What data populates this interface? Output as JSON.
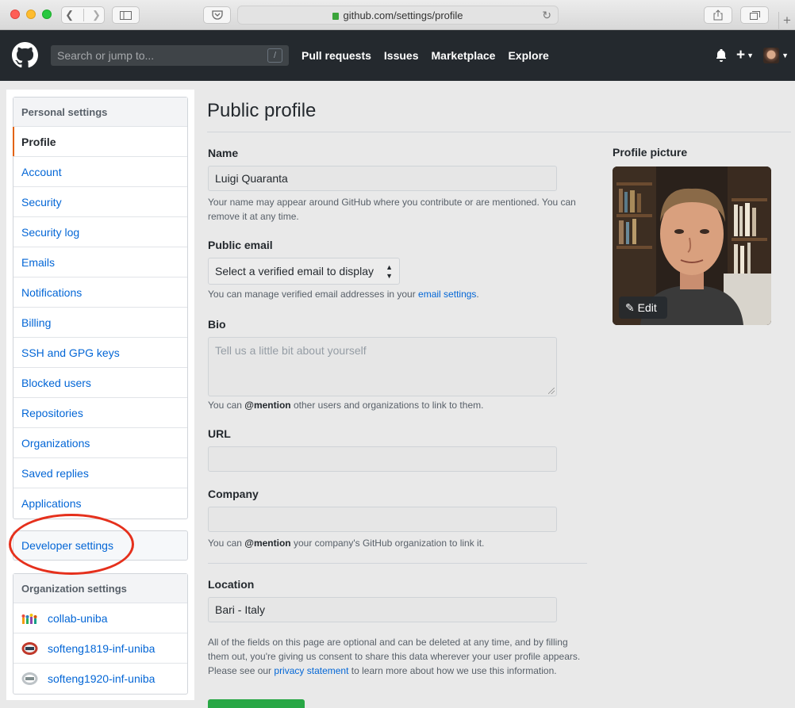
{
  "browser": {
    "url": "github.com/settings/profile"
  },
  "header": {
    "search_placeholder": "Search or jump to...",
    "slash_key": "/",
    "nav": [
      "Pull requests",
      "Issues",
      "Marketplace",
      "Explore"
    ],
    "plus": "+"
  },
  "sidebar": {
    "personal_heading": "Personal settings",
    "items": [
      {
        "label": "Profile",
        "selected": true
      },
      {
        "label": "Account"
      },
      {
        "label": "Security"
      },
      {
        "label": "Security log"
      },
      {
        "label": "Emails"
      },
      {
        "label": "Notifications"
      },
      {
        "label": "Billing"
      },
      {
        "label": "SSH and GPG keys"
      },
      {
        "label": "Blocked users"
      },
      {
        "label": "Repositories"
      },
      {
        "label": "Organizations"
      },
      {
        "label": "Saved replies"
      },
      {
        "label": "Applications"
      }
    ],
    "developer_settings": "Developer settings",
    "org_heading": "Organization settings",
    "orgs": [
      "collab-uniba",
      "softeng1819-inf-uniba",
      "softeng1920-inf-uniba"
    ]
  },
  "main": {
    "title": "Public profile",
    "name_label": "Name",
    "name_value": "Luigi Quaranta",
    "name_note": "Your name may appear around GitHub where you contribute or are mentioned. You can remove it at any time.",
    "email_label": "Public email",
    "email_select": "Select a verified email to display",
    "email_note_prefix": "You can manage verified email addresses in your ",
    "email_note_link": "email settings",
    "email_note_suffix": ".",
    "bio_label": "Bio",
    "bio_placeholder": "Tell us a little bit about yourself",
    "bio_note_prefix": "You can ",
    "bio_note_bold": "@mention",
    "bio_note_suffix": " other users and organizations to link to them.",
    "url_label": "URL",
    "url_value": "",
    "company_label": "Company",
    "company_value": "",
    "company_note_prefix": "You can ",
    "company_note_bold": "@mention",
    "company_note_suffix": " your company's GitHub organization to link it.",
    "location_label": "Location",
    "location_value": "Bari - Italy",
    "footer_note_prefix": "All of the fields on this page are optional and can be deleted at any time, and by filling them out, you're giving us consent to share this data wherever your user profile appears. Please see our ",
    "footer_note_link": "privacy statement",
    "footer_note_suffix": " to learn more about how we use this information."
  },
  "profile_picture": {
    "label": "Profile picture",
    "edit_label": "Edit"
  },
  "colors": {
    "header_bg": "#24292e",
    "link": "#0366d6",
    "selected_marker": "#e36209",
    "annotation_circle": "#e5301c",
    "primary_button": "#28a745"
  }
}
